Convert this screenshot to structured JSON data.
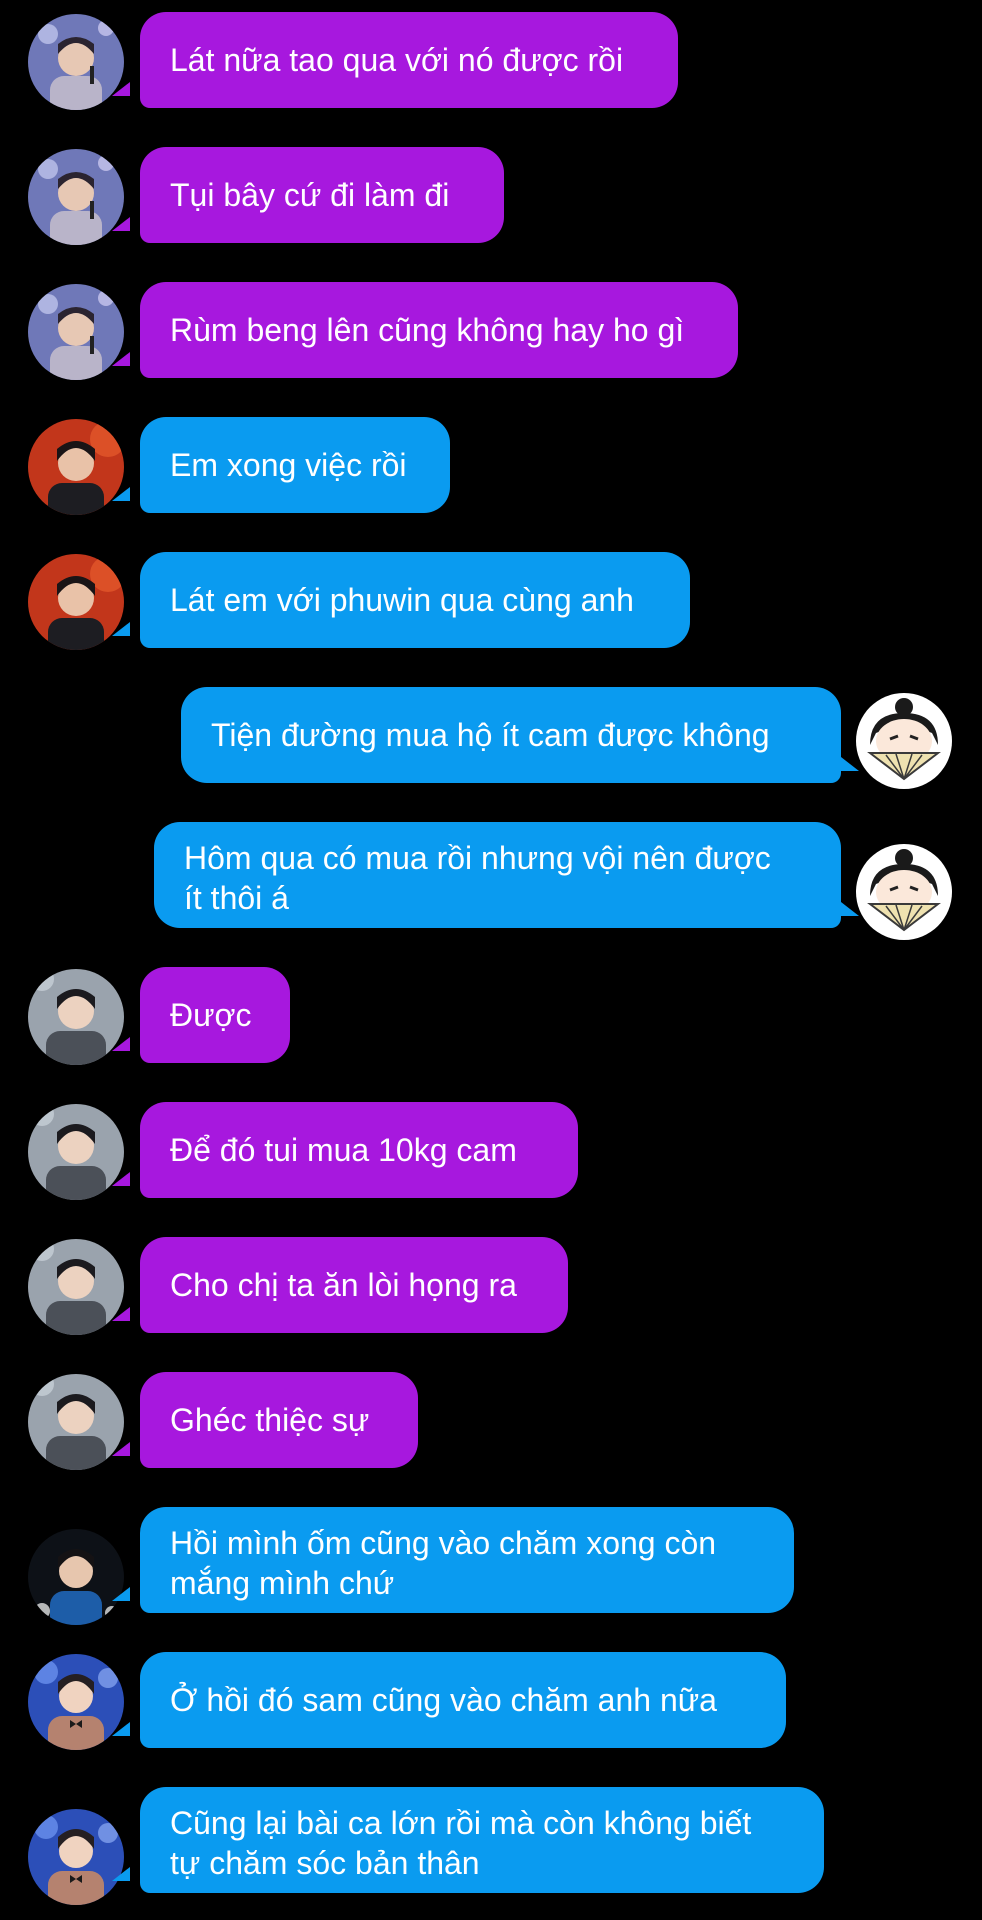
{
  "colors": {
    "background": "#000000",
    "bubble_purple": "#a718de",
    "bubble_blue": "#0a9bf0",
    "text": "#ffffff"
  },
  "messages": [
    {
      "text": "Lát nữa tao qua với nó được rồi",
      "color": "purple",
      "side": "left",
      "avatar": "avatar-man-stage-mic"
    },
    {
      "text": "Tụi bây cứ đi làm đi",
      "color": "purple",
      "side": "left",
      "avatar": "avatar-man-stage-mic"
    },
    {
      "text": "Rùm beng lên cũng không hay ho gì",
      "color": "purple",
      "side": "left",
      "avatar": "avatar-man-stage-mic"
    },
    {
      "text": "Em xong việc rồi",
      "color": "blue",
      "side": "left",
      "avatar": "avatar-man-red-background"
    },
    {
      "text": "Lát em với phuwin qua cùng anh",
      "color": "blue",
      "side": "left",
      "avatar": "avatar-man-red-background"
    },
    {
      "text": "Tiện đường mua hộ ít cam được không",
      "color": "blue",
      "side": "right",
      "avatar": "avatar-cartoon-girl-fan"
    },
    {
      "text": "Hôm qua có mua rồi nhưng vội nên được\nít thôi á",
      "color": "blue",
      "side": "right",
      "avatar": "avatar-cartoon-girl-fan"
    },
    {
      "text": "Được",
      "color": "purple",
      "side": "left",
      "avatar": "avatar-man-grey-jacket"
    },
    {
      "text": "Để đó tui mua 10kg cam",
      "color": "purple",
      "side": "left",
      "avatar": "avatar-man-grey-jacket"
    },
    {
      "text": "Cho chị ta ăn lòi họng ra",
      "color": "purple",
      "side": "left",
      "avatar": "avatar-man-grey-jacket"
    },
    {
      "text": "Ghéc thiệc sự",
      "color": "purple",
      "side": "left",
      "avatar": "avatar-man-grey-jacket"
    },
    {
      "text": "Hồi mình ốm cũng vào chăm xong còn\nmắng mình chứ",
      "color": "blue",
      "side": "left",
      "avatar": "avatar-man-dark-blue-shirt"
    },
    {
      "text": "Ở hồi đó sam cũng vào chăm anh nữa",
      "color": "blue",
      "side": "left",
      "avatar": "avatar-man-bowtie-blue-stage"
    },
    {
      "text": "Cũng lại bài ca lớn rồi mà còn không biết\ntự chăm sóc bản thân",
      "color": "blue",
      "side": "left",
      "avatar": "avatar-man-bowtie-blue-stage"
    }
  ]
}
